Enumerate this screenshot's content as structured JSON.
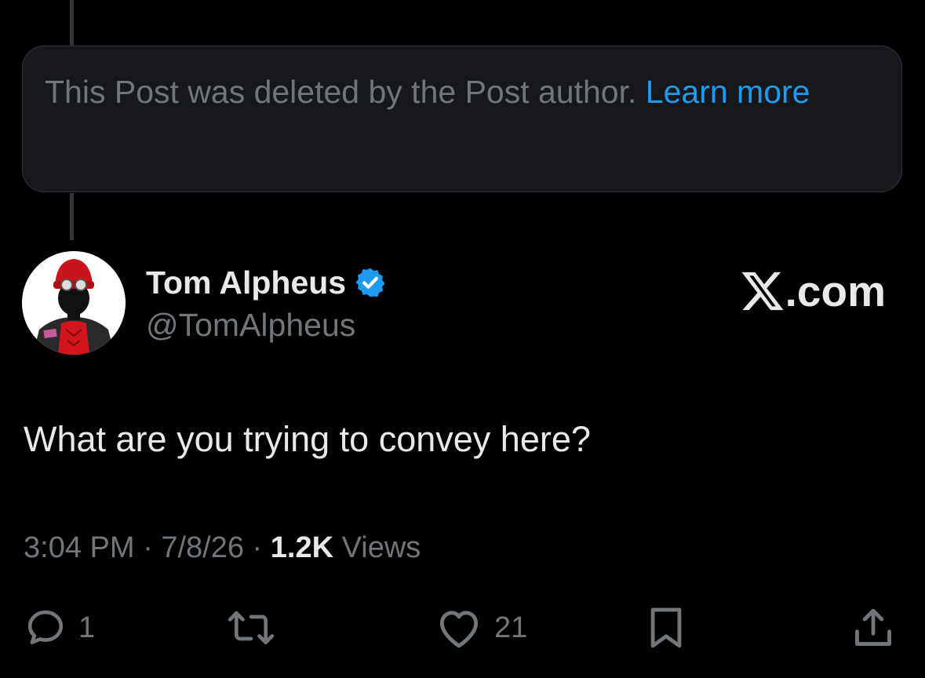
{
  "deleted_notice": {
    "text": "This Post was deleted by the Post author.",
    "link_label": "Learn more"
  },
  "author": {
    "display_name": "Tom Alpheus",
    "handle": "@TomAlpheus",
    "verified": true,
    "avatar_icon": "avatar-illustration"
  },
  "brand": {
    "label": ".com",
    "icon": "x-logo-icon"
  },
  "post": {
    "text": "What are you trying to convey here?"
  },
  "meta": {
    "time": "3:04 PM",
    "date": "7/8/26",
    "separator": "·",
    "views_count": "1.2K",
    "views_label": "Views"
  },
  "actions": {
    "reply_count": "1",
    "repost_count": "",
    "like_count": "21"
  },
  "colors": {
    "background": "#000000",
    "text_primary": "#e7e9ea",
    "text_secondary": "#71767b",
    "accent": "#1d9bf0",
    "card_bg": "#16181c",
    "border": "#2f3336"
  }
}
